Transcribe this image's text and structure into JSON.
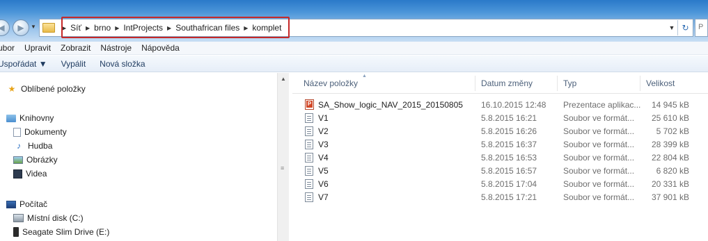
{
  "address": {
    "crumbs": [
      "Síť",
      "brno",
      "IntProjects",
      "Southafrican files",
      "komplet"
    ]
  },
  "menu": [
    "ubor",
    "Upravit",
    "Zobrazit",
    "Nástroje",
    "Nápověda"
  ],
  "toolbar": {
    "organize": "Uspořádat ▼",
    "burn": "Vypálit",
    "new_folder": "Nová složka"
  },
  "search_stub": "P",
  "nav": {
    "favorites": "Oblíbené položky",
    "libraries": "Knihovny",
    "documents": "Dokumenty",
    "music": "Hudba",
    "pictures": "Obrázky",
    "videos": "Videa",
    "computer": "Počítač",
    "local_disk": "Místní disk (C:)",
    "seagate": "Seagate Slim Drive (E:)"
  },
  "columns": {
    "name": "Název položky",
    "date": "Datum změny",
    "type": "Typ",
    "size": "Velikost"
  },
  "files": [
    {
      "name": "SA_Show_logic_NAV_2015_20150805",
      "date": "16.10.2015 12:48",
      "type": "Prezentace aplikac...",
      "size": "14 945 kB",
      "icon": "powerpoint-icon"
    },
    {
      "name": "V1",
      "date": "5.8.2015 16:21",
      "type": "Soubor ve formát...",
      "size": "25 610 kB",
      "icon": "video-file-icon"
    },
    {
      "name": "V2",
      "date": "5.8.2015 16:26",
      "type": "Soubor ve formát...",
      "size": "5 702 kB",
      "icon": "video-file-icon"
    },
    {
      "name": "V3",
      "date": "5.8.2015 16:37",
      "type": "Soubor ve formát...",
      "size": "28 399 kB",
      "icon": "video-file-icon"
    },
    {
      "name": "V4",
      "date": "5.8.2015 16:53",
      "type": "Soubor ve formát...",
      "size": "22 804 kB",
      "icon": "video-file-icon"
    },
    {
      "name": "V5",
      "date": "5.8.2015 16:57",
      "type": "Soubor ve formát...",
      "size": "6 820 kB",
      "icon": "video-file-icon"
    },
    {
      "name": "V6",
      "date": "5.8.2015 17:04",
      "type": "Soubor ve formát...",
      "size": "20 331 kB",
      "icon": "video-file-icon"
    },
    {
      "name": "V7",
      "date": "5.8.2015 17:21",
      "type": "Soubor ve formát...",
      "size": "37 901 kB",
      "icon": "video-file-icon"
    }
  ],
  "colors": {
    "highlight_box": "#c62828",
    "title_gradient_top": "#2a79c9"
  }
}
